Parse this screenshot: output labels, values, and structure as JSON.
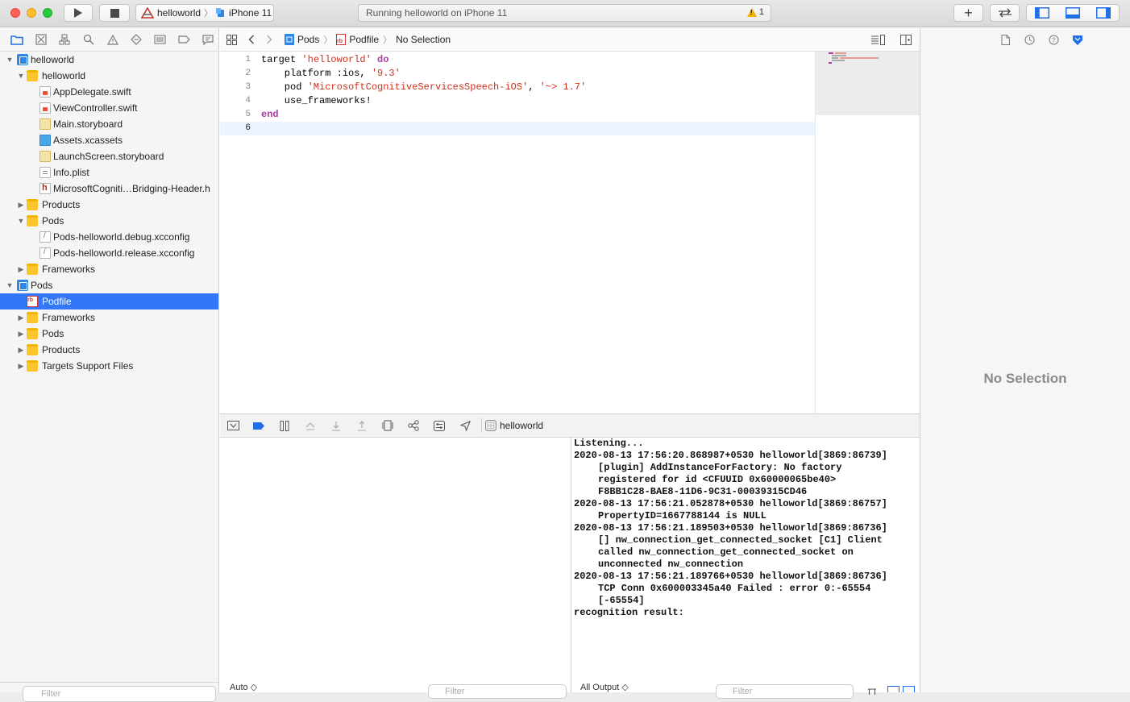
{
  "toolbar": {
    "scheme_target": "helloworld",
    "scheme_device": "iPhone 11",
    "activity_status": "Running helloworld on iPhone 11",
    "warning_count": "1",
    "add_label": "+"
  },
  "navigator": {
    "tree": [
      {
        "label": "helloworld",
        "kind": "project",
        "depth": 0,
        "disclosure": "open"
      },
      {
        "label": "helloworld",
        "kind": "folder",
        "depth": 1,
        "disclosure": "open"
      },
      {
        "label": "AppDelegate.swift",
        "kind": "swift",
        "depth": 2,
        "disclosure": ""
      },
      {
        "label": "ViewController.swift",
        "kind": "swift",
        "depth": 2,
        "disclosure": ""
      },
      {
        "label": "Main.storyboard",
        "kind": "story",
        "depth": 2,
        "disclosure": ""
      },
      {
        "label": "Assets.xcassets",
        "kind": "assets",
        "depth": 2,
        "disclosure": ""
      },
      {
        "label": "LaunchScreen.storyboard",
        "kind": "story",
        "depth": 2,
        "disclosure": ""
      },
      {
        "label": "Info.plist",
        "kind": "plist",
        "depth": 2,
        "disclosure": ""
      },
      {
        "label": "MicrosoftCogniti…Bridging-Header.h",
        "kind": "hfile",
        "depth": 2,
        "disclosure": ""
      },
      {
        "label": "Products",
        "kind": "folder",
        "depth": 1,
        "disclosure": "closed"
      },
      {
        "label": "Pods",
        "kind": "folder",
        "depth": 1,
        "disclosure": "open"
      },
      {
        "label": "Pods-helloworld.debug.xcconfig",
        "kind": "cfg",
        "depth": 2,
        "disclosure": ""
      },
      {
        "label": "Pods-helloworld.release.xcconfig",
        "kind": "cfg",
        "depth": 2,
        "disclosure": ""
      },
      {
        "label": "Frameworks",
        "kind": "folder",
        "depth": 1,
        "disclosure": "closed"
      },
      {
        "label": "Pods",
        "kind": "project",
        "depth": 0,
        "disclosure": "open"
      },
      {
        "label": "Podfile",
        "kind": "rb",
        "depth": 1,
        "disclosure": "",
        "selected": true
      },
      {
        "label": "Frameworks",
        "kind": "folder",
        "depth": 1,
        "disclosure": "closed"
      },
      {
        "label": "Pods",
        "kind": "folder",
        "depth": 1,
        "disclosure": "closed"
      },
      {
        "label": "Products",
        "kind": "folder",
        "depth": 1,
        "disclosure": "closed"
      },
      {
        "label": "Targets Support Files",
        "kind": "folder",
        "depth": 1,
        "disclosure": "closed"
      }
    ],
    "filter_placeholder": "Filter"
  },
  "jumpbar": {
    "crumb1": "Pods",
    "crumb2": "Podfile",
    "crumb3": "No Selection"
  },
  "editor": {
    "lines": [
      {
        "n": "1",
        "tokens": [
          {
            "t": "target ",
            "c": "plain"
          },
          {
            "t": "'helloworld'",
            "c": "str"
          },
          {
            "t": " ",
            "c": "plain"
          },
          {
            "t": "do",
            "c": "kw"
          }
        ]
      },
      {
        "n": "2",
        "tokens": [
          {
            "t": "    platform :ios, ",
            "c": "plain"
          },
          {
            "t": "'9.3'",
            "c": "str"
          }
        ]
      },
      {
        "n": "3",
        "tokens": [
          {
            "t": "    pod ",
            "c": "plain"
          },
          {
            "t": "'MicrosoftCognitiveServicesSpeech-iOS'",
            "c": "str"
          },
          {
            "t": ", ",
            "c": "plain"
          },
          {
            "t": "'~> 1.7'",
            "c": "str"
          }
        ]
      },
      {
        "n": "4",
        "tokens": [
          {
            "t": "    use_frameworks!",
            "c": "plain"
          }
        ]
      },
      {
        "n": "5",
        "tokens": [
          {
            "t": "end",
            "c": "kw"
          }
        ]
      },
      {
        "n": "6",
        "tokens": [],
        "current": true
      }
    ]
  },
  "debug": {
    "process_name": "helloworld",
    "variables_mode": "Auto ◇",
    "console_mode": "All Output ◇",
    "filter_placeholder": "Filter"
  },
  "console": {
    "lines": [
      {
        "text": "Listening...",
        "indent": false
      },
      {
        "text": "2020-08-13 17:56:20.868987+0530 helloworld[3869:86739]",
        "indent": false
      },
      {
        "text": "[plugin] AddInstanceForFactory: No factory",
        "indent": true
      },
      {
        "text": "registered for id <CFUUID 0x60000065be40>",
        "indent": true
      },
      {
        "text": "F8BB1C28-BAE8-11D6-9C31-00039315CD46",
        "indent": true
      },
      {
        "text": "2020-08-13 17:56:21.052878+0530 helloworld[3869:86757]",
        "indent": false
      },
      {
        "text": "PropertyID=1667788144 is NULL",
        "indent": true
      },
      {
        "text": "2020-08-13 17:56:21.189503+0530 helloworld[3869:86736]",
        "indent": false
      },
      {
        "text": "[] nw_connection_get_connected_socket [C1] Client",
        "indent": true
      },
      {
        "text": "called nw_connection_get_connected_socket on",
        "indent": true
      },
      {
        "text": "unconnected nw_connection",
        "indent": true
      },
      {
        "text": "2020-08-13 17:56:21.189766+0530 helloworld[3869:86736]",
        "indent": false
      },
      {
        "text": "TCP Conn 0x600003345a40 Failed : error 0:-65554",
        "indent": true
      },
      {
        "text": "[-65554]",
        "indent": true
      },
      {
        "text": "recognition result:",
        "indent": false
      }
    ]
  },
  "inspector": {
    "empty_label": "No Selection"
  },
  "colors": {
    "accent": "#3477f6",
    "keyword": "#ad3da4",
    "string": "#d12f1b"
  }
}
